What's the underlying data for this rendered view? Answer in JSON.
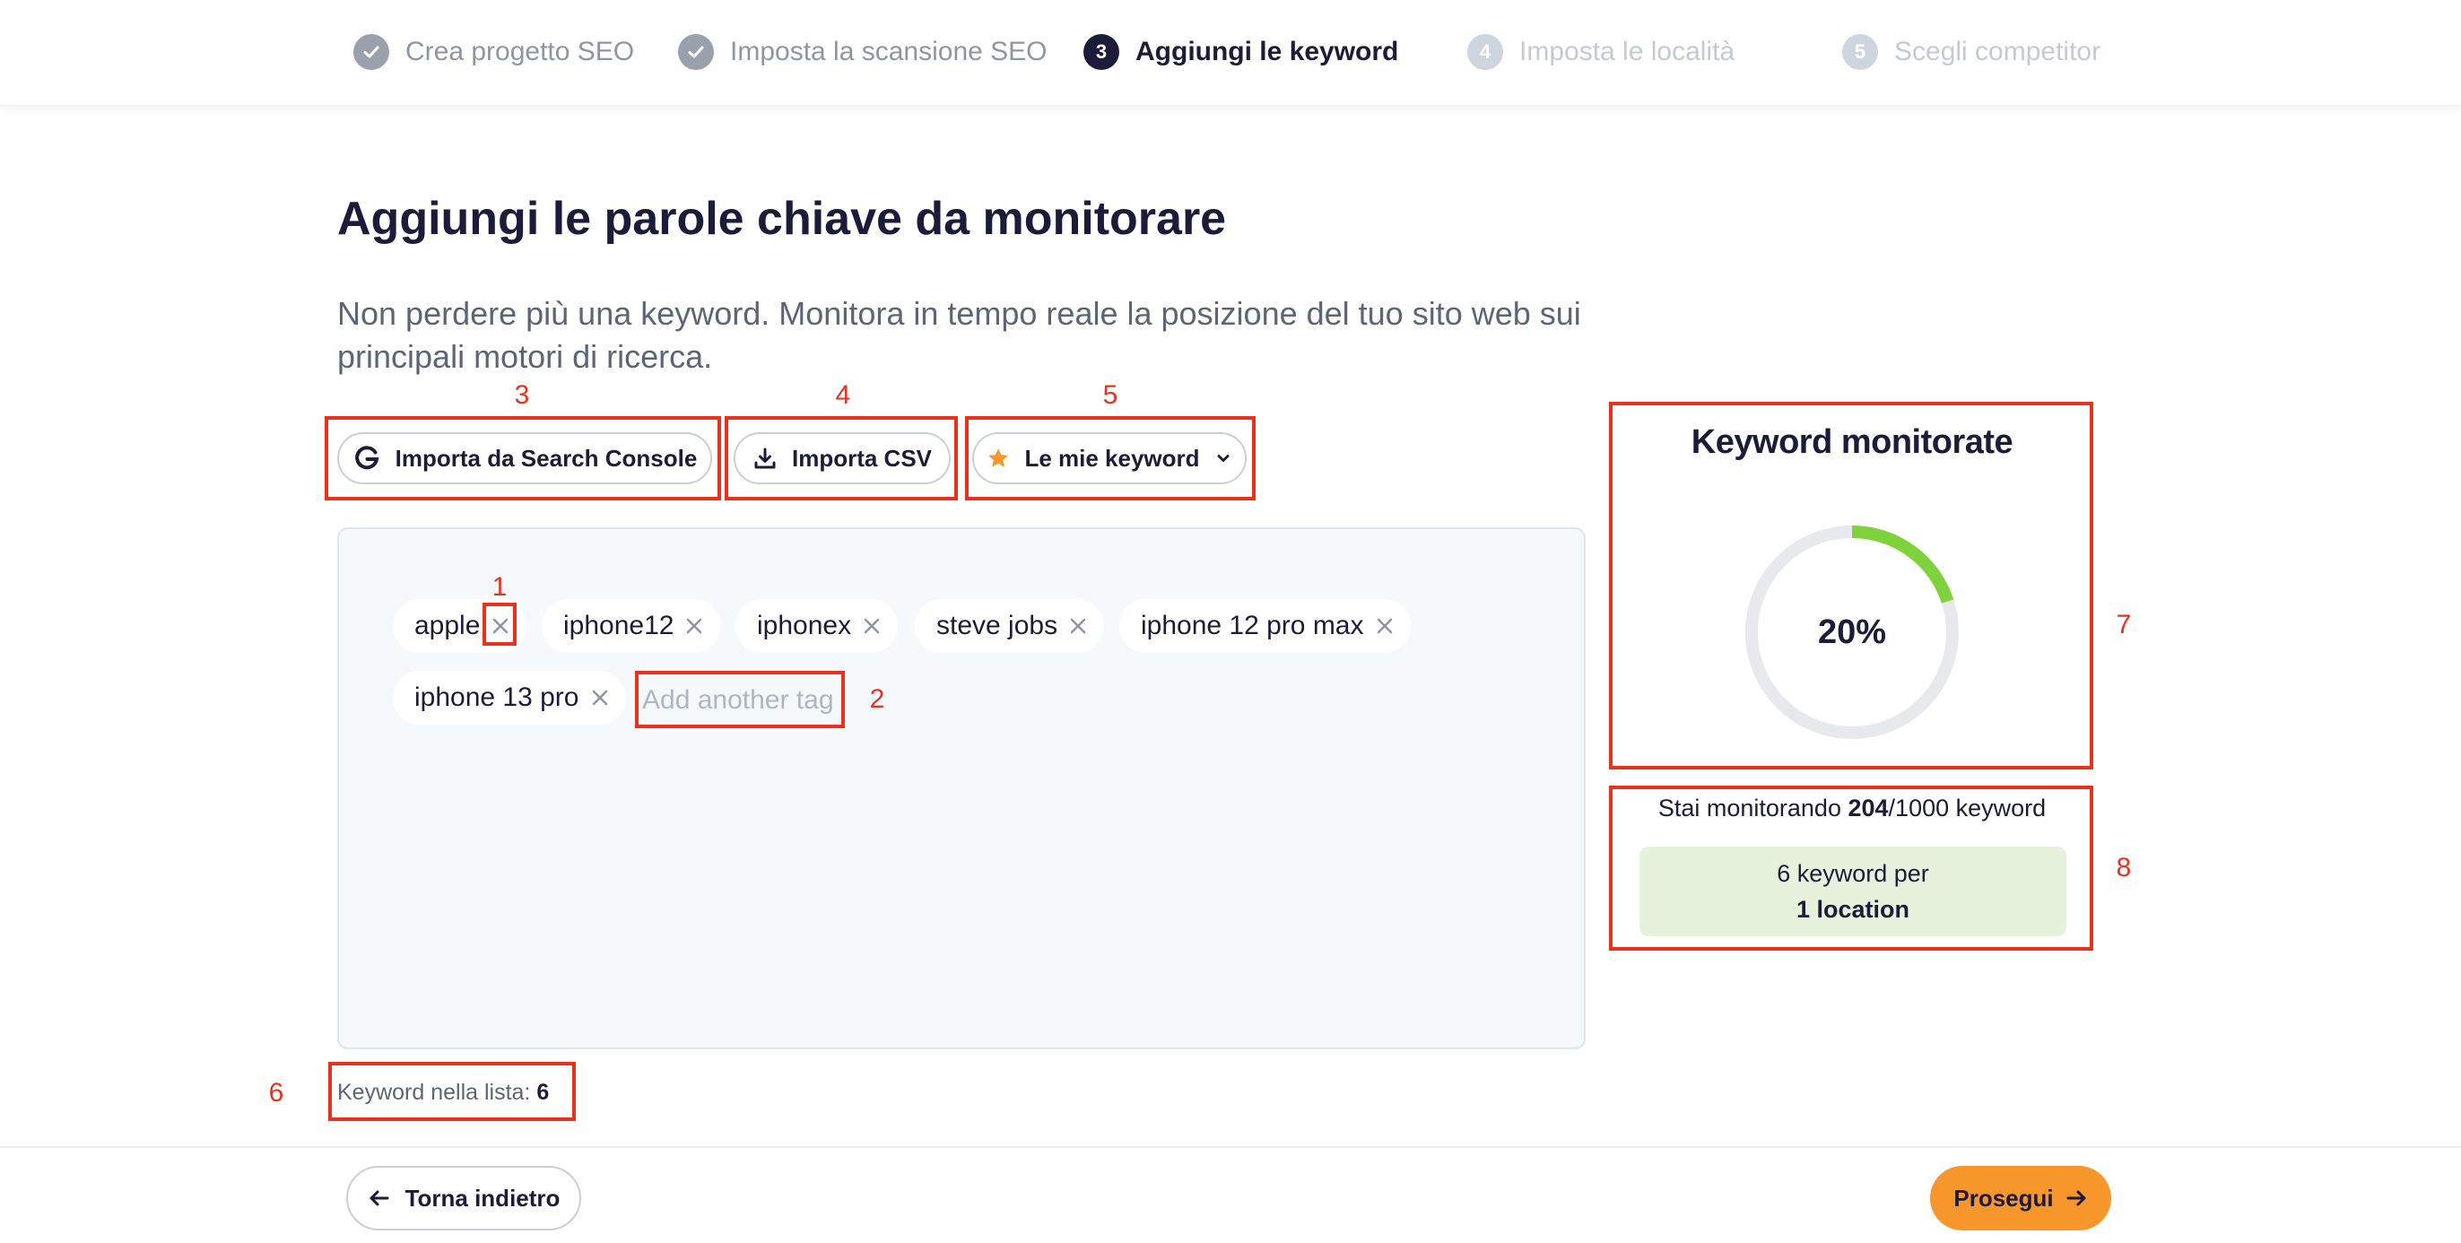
{
  "stepper": {
    "steps": [
      {
        "label": "Crea progetto SEO",
        "number": "1",
        "state": "done"
      },
      {
        "label": "Imposta la scansione SEO",
        "number": "2",
        "state": "done"
      },
      {
        "label": "Aggiungi le keyword",
        "number": "3",
        "state": "active"
      },
      {
        "label": "Imposta le località",
        "number": "4",
        "state": "todo"
      },
      {
        "label": "Scegli competitor",
        "number": "5",
        "state": "todo"
      }
    ]
  },
  "main": {
    "title": "Aggiungi le parole chiave da monitorare",
    "subtitle": "Non perdere più una keyword. Monitora in tempo reale la posizione del tuo sito web sui principali motori di ricerca."
  },
  "toolbar": {
    "import_search_console": "Importa da Search Console",
    "import_csv": "Importa CSV",
    "my_keywords": "Le mie keyword"
  },
  "tags": {
    "items": [
      "apple",
      "iphone12",
      "iphonex",
      "steve jobs",
      "iphone 12 pro max",
      "iphone 13 pro"
    ],
    "input_placeholder": "Add another tag"
  },
  "list_count": {
    "label": "Keyword nella lista:",
    "value": "6"
  },
  "keyword_panel": {
    "title": "Keyword monitorate",
    "percent_label": "20%",
    "percent_value": 0.2,
    "monitor_prefix": "Stai monitorando",
    "monitor_count": "204",
    "monitor_suffix": "/1000 keyword",
    "location_line1": "6 keyword per",
    "location_line2": "1 location"
  },
  "footer": {
    "back_label": "Torna indietro",
    "next_label": "Prosegui"
  },
  "annotations": [
    "1",
    "2",
    "3",
    "4",
    "5",
    "6",
    "7",
    "8"
  ],
  "colors": {
    "accent": "#f7962a",
    "annotation": "#e8321e",
    "gauge_fill": "#7ed23c",
    "gauge_track": "#e8e9ec",
    "dark": "#1c1b3a",
    "location_bg": "#e6f2dc",
    "star": "#f7962a"
  }
}
